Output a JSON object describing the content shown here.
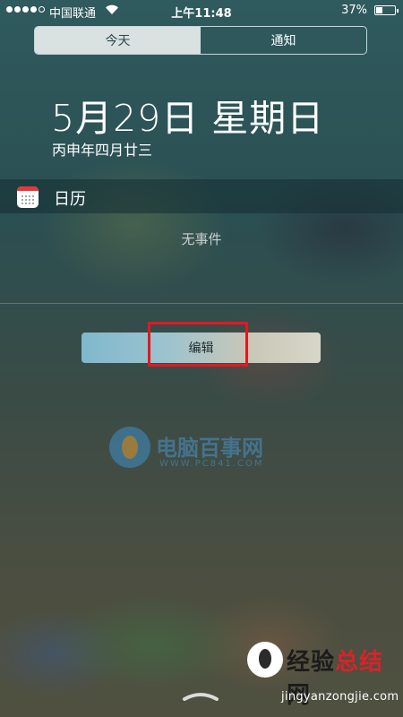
{
  "status_bar": {
    "carrier": "中国联通",
    "time": "上午11:48",
    "battery": "37%",
    "battery_level": 0.37,
    "signal_bars_filled": 4,
    "signal_bars_total": 5
  },
  "tabs": [
    {
      "label": "今天",
      "selected": true
    },
    {
      "label": "通知",
      "selected": false
    }
  ],
  "date": {
    "main": "5月29日 星期日",
    "lunar": "丙申年四月廿三"
  },
  "widget": {
    "title": "日历",
    "empty_text": "无事件"
  },
  "edit_button": {
    "label": "编辑"
  },
  "watermark": {
    "name": "电脑百事网",
    "url": "WWW.PC841.COM"
  },
  "corner_watermark": {
    "title_dark": "经验",
    "title_red": "总结",
    "title_end": "网",
    "url": "jingyanzongjie.com"
  },
  "colors": {
    "highlight": "#e8161e",
    "calendar_icon_red": "#e03a3a"
  }
}
